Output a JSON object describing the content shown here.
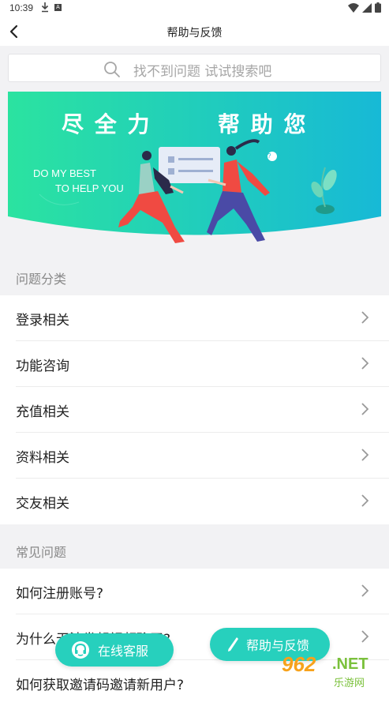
{
  "status_bar": {
    "time": "10:39",
    "download_icon": "download-icon",
    "app_icon_text": "A"
  },
  "header": {
    "title": "帮助与反馈",
    "back_icon": "chevron-left-icon"
  },
  "search": {
    "placeholder": "找不到问题 试试搜索吧"
  },
  "banner": {
    "title_left": "尽 全 力",
    "title_right": "帮 助 您",
    "subtitle_line1": "DO MY BEST",
    "subtitle_line2": "TO HELP YOU",
    "colors": {
      "start": "#2be3a0",
      "end": "#17b9d6"
    }
  },
  "categories": {
    "title": "问题分类",
    "items": [
      {
        "label": "登录相关"
      },
      {
        "label": "功能咨询"
      },
      {
        "label": "充值相关"
      },
      {
        "label": "资料相关"
      },
      {
        "label": "交友相关"
      }
    ]
  },
  "faq": {
    "title": "常见问题",
    "items": [
      {
        "label": "如何注册账号?"
      },
      {
        "label": "为什么无法发起视频聊天?"
      },
      {
        "label": "如何获取邀请码邀请新用户?"
      }
    ]
  },
  "fabs": {
    "online_service": "在线客服",
    "help_feedback": "帮助与反馈"
  },
  "watermark": {
    "text_962": "962",
    "text_net": ".NET",
    "text_cn": "乐游网"
  },
  "colors": {
    "accent": "#27d0bd"
  }
}
